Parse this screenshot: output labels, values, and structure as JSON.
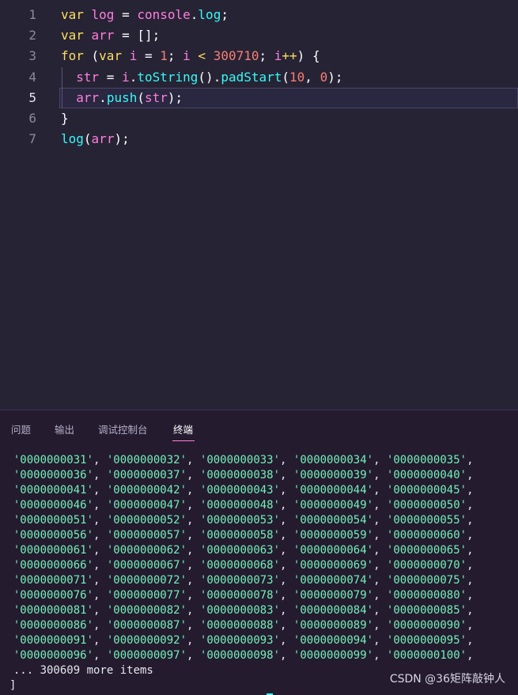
{
  "editor": {
    "lines": [
      {
        "num": "1",
        "tokens": [
          [
            "kw",
            "var "
          ],
          [
            "var",
            "log"
          ],
          [
            "pl",
            " = "
          ],
          [
            "var",
            "console"
          ],
          [
            "pl",
            "."
          ],
          [
            "fn",
            "log"
          ],
          [
            "pl",
            ";"
          ]
        ]
      },
      {
        "num": "2",
        "tokens": [
          [
            "kw",
            "var "
          ],
          [
            "var",
            "arr"
          ],
          [
            "pl",
            " = [];"
          ]
        ]
      },
      {
        "num": "3",
        "tokens": [
          [
            "kw",
            "for "
          ],
          [
            "pl",
            "("
          ],
          [
            "kw",
            "var "
          ],
          [
            "var",
            "i"
          ],
          [
            "pl",
            " = "
          ],
          [
            "num",
            "1"
          ],
          [
            "pl",
            "; "
          ],
          [
            "var",
            "i"
          ],
          [
            "op",
            " < "
          ],
          [
            "num",
            "300710"
          ],
          [
            "pl",
            "; "
          ],
          [
            "var",
            "i"
          ],
          [
            "op",
            "++"
          ],
          [
            "pl",
            ") {"
          ]
        ]
      },
      {
        "num": "4",
        "tokens": [
          [
            "pl",
            "  "
          ],
          [
            "var",
            "str"
          ],
          [
            "pl",
            " = "
          ],
          [
            "var",
            "i"
          ],
          [
            "pl",
            "."
          ],
          [
            "fn",
            "toString"
          ],
          [
            "pl",
            "()."
          ],
          [
            "fn",
            "padStart"
          ],
          [
            "pl",
            "("
          ],
          [
            "num",
            "10"
          ],
          [
            "pl",
            ", "
          ],
          [
            "num",
            "0"
          ],
          [
            "pl",
            ");"
          ]
        ]
      },
      {
        "num": "5",
        "tokens": [
          [
            "pl",
            "  "
          ],
          [
            "var",
            "arr"
          ],
          [
            "pl",
            "."
          ],
          [
            "fn",
            "push"
          ],
          [
            "pl",
            "("
          ],
          [
            "var",
            "str"
          ],
          [
            "pl",
            ");"
          ]
        ]
      },
      {
        "num": "6",
        "tokens": [
          [
            "pl",
            "}"
          ]
        ]
      },
      {
        "num": "7",
        "tokens": [
          [
            "fn",
            "log"
          ],
          [
            "pl",
            "("
          ],
          [
            "var",
            "arr"
          ],
          [
            "pl",
            ");"
          ]
        ]
      }
    ],
    "active_line": "5"
  },
  "panel": {
    "tabs": [
      {
        "label": "问题",
        "active": false
      },
      {
        "label": "输出",
        "active": false
      },
      {
        "label": "调试控制台",
        "active": false
      },
      {
        "label": "终端",
        "active": true
      }
    ]
  },
  "terminal": {
    "rows": [
      [
        "'0000000031'",
        "'0000000032'",
        "'0000000033'",
        "'0000000034'",
        "'0000000035'"
      ],
      [
        "'0000000036'",
        "'0000000037'",
        "'0000000038'",
        "'0000000039'",
        "'0000000040'"
      ],
      [
        "'0000000041'",
        "'0000000042'",
        "'0000000043'",
        "'0000000044'",
        "'0000000045'"
      ],
      [
        "'0000000046'",
        "'0000000047'",
        "'0000000048'",
        "'0000000049'",
        "'0000000050'"
      ],
      [
        "'0000000051'",
        "'0000000052'",
        "'0000000053'",
        "'0000000054'",
        "'0000000055'"
      ],
      [
        "'0000000056'",
        "'0000000057'",
        "'0000000058'",
        "'0000000059'",
        "'0000000060'"
      ],
      [
        "'0000000061'",
        "'0000000062'",
        "'0000000063'",
        "'0000000064'",
        "'0000000065'"
      ],
      [
        "'0000000066'",
        "'0000000067'",
        "'0000000068'",
        "'0000000069'",
        "'0000000070'"
      ],
      [
        "'0000000071'",
        "'0000000072'",
        "'0000000073'",
        "'0000000074'",
        "'0000000075'"
      ],
      [
        "'0000000076'",
        "'0000000077'",
        "'0000000078'",
        "'0000000079'",
        "'0000000080'"
      ],
      [
        "'0000000081'",
        "'0000000082'",
        "'0000000083'",
        "'0000000084'",
        "'0000000085'"
      ],
      [
        "'0000000086'",
        "'0000000087'",
        "'0000000088'",
        "'0000000089'",
        "'0000000090'"
      ],
      [
        "'0000000091'",
        "'0000000092'",
        "'0000000093'",
        "'0000000094'",
        "'0000000095'"
      ],
      [
        "'0000000096'",
        "'0000000097'",
        "'0000000098'",
        "'0000000099'",
        "'0000000100'"
      ]
    ],
    "more_items": "  ... 300609 more items",
    "closing_bracket": "]"
  },
  "watermark": "CSDN @36矩阵敲钟人",
  "colors": {
    "editor_bg": "#262335",
    "panel_bg": "#241b2f",
    "string": "#72f1b8",
    "keyword": "#fede5d",
    "variable": "#ff7edb",
    "function": "#36f9f6",
    "number": "#f97e72"
  }
}
